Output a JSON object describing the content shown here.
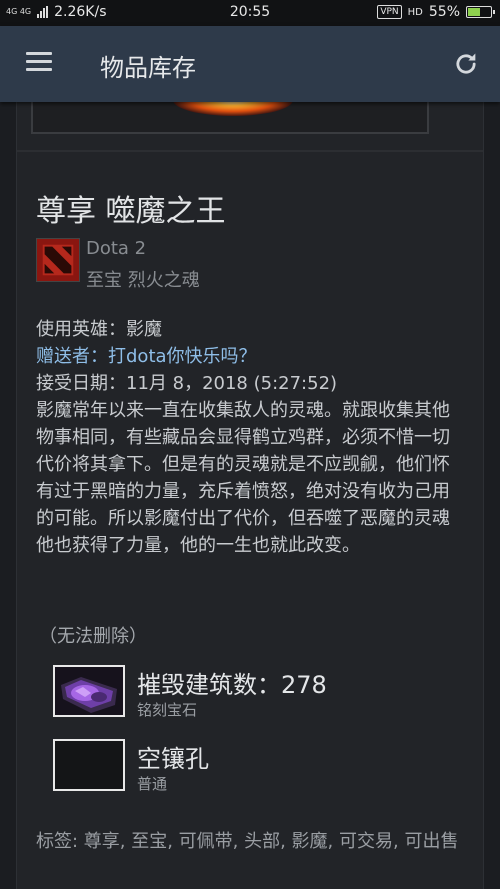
{
  "status_bar": {
    "network": "4G 4G",
    "speed": "2.26K/s",
    "time": "20:55",
    "vpn": "VPN",
    "hd": "HD",
    "battery": "55%",
    "battery_level": 0.55
  },
  "app_bar": {
    "title": "物品库存"
  },
  "item": {
    "name": "尊享 噬魔之王",
    "game": "Dota 2",
    "type": "至宝 烈火之魂",
    "hero": "使用英雄：影魔",
    "gift_from": "赠送者：打dota你快乐吗？",
    "received": "接受日期：11月 8，2018 (5:27:52)",
    "description": "影魔常年以来一直在收集敌人的灵魂。就跟收集其他物事相同，有些藏品会显得鹤立鸡群，必须不惜一切代价将其拿下。但是有的灵魂就是不应觊觎，他们怀有过于黑暗的力量，充斥着愤怒，绝对没有收为己用的可能。所以影魔付出了代价，但吞噬了恶魔的灵魂他也获得了力量，他的一生也就此改变。",
    "no_delete": "（无法删除）",
    "gems": [
      {
        "title": "摧毁建筑数：278",
        "subtitle": "铭刻宝石"
      },
      {
        "title": "空镶孔",
        "subtitle": "普通"
      }
    ],
    "tags": "标签: 尊享, 至宝, 可佩带, 头部, 影魔, 可交易, 可出售"
  },
  "colors": {
    "app_bar": "#2e3a4a",
    "background": "#1b1d21",
    "gift_link": "#8fbee8",
    "battery": "#8fd14f"
  }
}
